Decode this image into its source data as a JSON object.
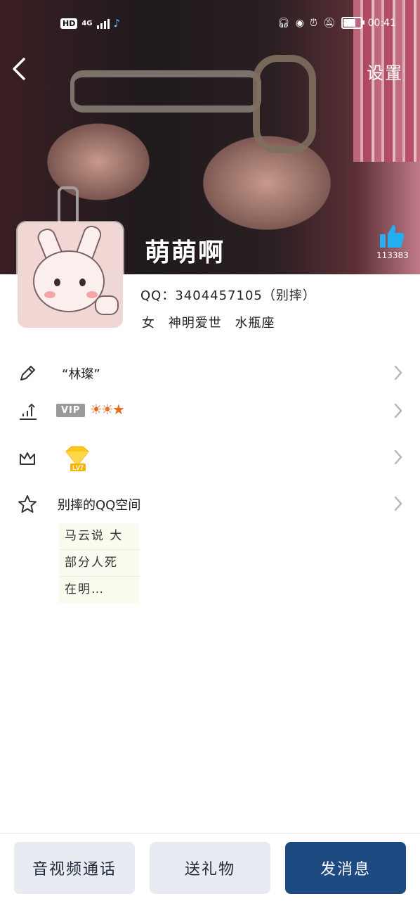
{
  "status_bar": {
    "left": {
      "hd_label": "HD",
      "network_label": "4G"
    },
    "time": "00:41",
    "battery_percent": 80
  },
  "header": {
    "back_icon": "chevron-left-icon",
    "settings_label": "设置"
  },
  "profile": {
    "nickname": "萌萌啊",
    "like_count": "113383",
    "qq_line": "QQ：3404457105（别摔）",
    "gender": "女",
    "tag": "神明爱世",
    "constellation": "水瓶座"
  },
  "rows": {
    "signature": {
      "icon": "pencil-icon",
      "text": "“林璨”"
    },
    "vip": {
      "icon": "level-chart-icon",
      "badge": "VIP",
      "level_icons": "☀☀★"
    },
    "crown": {
      "icon": "crown-icon",
      "diamond_level": "LV7"
    },
    "space": {
      "icon": "star-icon",
      "text": "别摔的QQ空间"
    }
  },
  "space_preview": {
    "lines": [
      "马云说 大",
      "部分人死",
      "在明…"
    ]
  },
  "actions": {
    "av_call": "音视频通话",
    "send_gift": "送礼物",
    "send_message": "发消息"
  }
}
